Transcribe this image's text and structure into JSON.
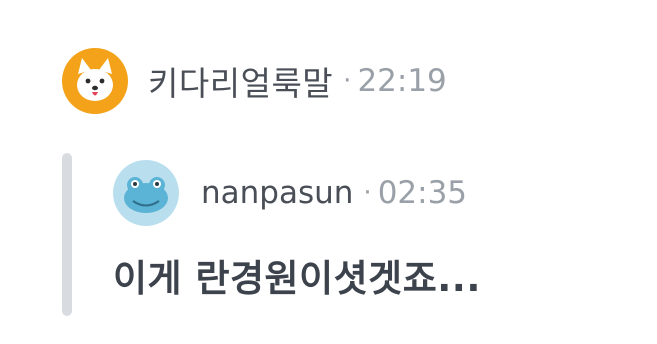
{
  "post": {
    "author": "키다리얼룩말",
    "separator": "·",
    "time": "22:19",
    "avatar_icon": "dog-avatar-icon"
  },
  "quote": {
    "author": "nanpasun",
    "separator": "·",
    "time": "02:35",
    "avatar_icon": "frog-avatar-icon",
    "text": "이게 란경원이셧겟죠..."
  },
  "colors": {
    "dog_avatar_bg": "#f3a21a",
    "frog_avatar_bg": "#b9dfee",
    "quote_bar": "#d8dce1",
    "muted_text": "#9aa0a8",
    "name_text": "#4a4f57"
  }
}
